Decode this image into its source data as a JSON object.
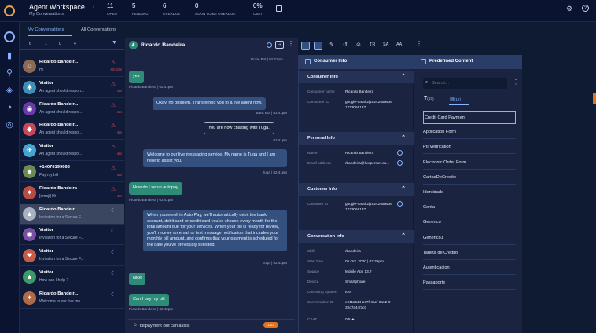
{
  "header": {
    "title": "Agent Workspace",
    "subtitle": "My Conversations",
    "stats": [
      {
        "value": "11",
        "label": "OPEN"
      },
      {
        "value": "5",
        "label": "PENDING"
      },
      {
        "value": "6",
        "label": "OVERDUE"
      },
      {
        "value": "0",
        "label": "SOON TO BE OVERDUE"
      },
      {
        "value": "0%",
        "label": "CSAT"
      }
    ]
  },
  "tabs": {
    "mine": "My Conversations",
    "all": "All Conversations"
  },
  "counts": [
    "6",
    "1",
    "0",
    "4"
  ],
  "conversations": [
    {
      "name": "Ricardo Bandeir...",
      "preview": "Hi",
      "time": "4m 15s",
      "color": "#8b6a55",
      "icon": "☺"
    },
    {
      "name": "Visitor",
      "preview": "An agent should respon...",
      "time": "4m",
      "color": "#3d8fb6",
      "icon": "✱"
    },
    {
      "name": "Ricardo Bandeir...",
      "preview": "An agent should respo...",
      "time": "4m",
      "color": "#6a3ba8",
      "icon": "◉"
    },
    {
      "name": "Ricardo Bandeir...",
      "preview": "An agent should respo...",
      "time": "4m",
      "color": "#c9475a",
      "icon": "◆"
    },
    {
      "name": "Visitor",
      "preview": "An agent should respo...",
      "time": "4m",
      "color": "#47a4d1",
      "icon": "✈"
    },
    {
      "name": "+14076199663",
      "preview": "Pay my bill",
      "time": "4m",
      "color": "#6b8b52",
      "icon": "☻"
    },
    {
      "name": "Ricardo Bandeira",
      "preview": "[emoji] Hi",
      "time": "4m",
      "color": "#b84e43",
      "icon": "✷"
    },
    {
      "name": "Ricardo Bandeir...",
      "preview": "Invitation for a Secure F...",
      "time": "",
      "color": "#a8b2c2",
      "icon": "▲"
    },
    {
      "name": "Visitor",
      "preview": "Invitation for a Secure F...",
      "time": "",
      "color": "#7b4fa4",
      "icon": "◉"
    },
    {
      "name": "Visitor",
      "preview": "Invitation for a Secure F...",
      "time": "",
      "color": "#c65b4a",
      "icon": "❤"
    },
    {
      "name": "Visitor",
      "preview": "How can I help ?",
      "time": "",
      "color": "#3d9a6a",
      "icon": "▲"
    },
    {
      "name": "Ricardo Bandeir...",
      "preview": "Welcome to our live me...",
      "time": "",
      "color": "#b06a47",
      "icon": "✶"
    }
  ],
  "chat": {
    "contact": "Ricardo Bandeira",
    "top_meta": "Rosie Bot | 02:41pm",
    "messages": [
      {
        "dir": "in",
        "text": "yes",
        "meta": "Ricardo Bandeira | 02:41pm"
      },
      {
        "dir": "out",
        "text": "Okay, no problem. Transferring you to a live agent now.",
        "meta": "Bank Bot | 02:41pm"
      },
      {
        "dir": "sys",
        "text": "You are now chatting with Tuga.",
        "meta": "02:41pm"
      },
      {
        "dir": "out",
        "text": "Welcome to our live messaging service. My name is Tuga and I am here to assist you.",
        "meta": "Tuga | 02:41pm"
      },
      {
        "dir": "in",
        "text": "How do I setup autopay",
        "meta": "Ricardo Bandeira | 02:41pm"
      },
      {
        "dir": "out",
        "text": "When you enroll in Auto Pay, we'll automatically debit the bank account, debit card or credit card you've chosen every month for the total amount due for your services. When your bill is ready for review, you'll receive an email or text message notification that includes your monthly bill amount, and confirms that your payment is scheduled for the date you've previously selected.",
        "meta": "Tuga | 02:42pm"
      },
      {
        "dir": "in",
        "text": "Nice",
        "meta": ""
      },
      {
        "dir": "in",
        "text": "Can I pay my bill",
        "meta": "Ricardo Bandeira | 02:42pm"
      }
    ],
    "bot_assist": "billpayment Bot can assist",
    "bot_badge": "1:23"
  },
  "consumer": {
    "title": "Consumer Info",
    "sections": [
      {
        "title": "Consumer Info",
        "fields": [
          [
            "Consumer name",
            "Ricardo Bandeira"
          ],
          [
            "Consumer ID",
            "google-oauth2|102425595361773066137"
          ]
        ]
      },
      {
        "title": "Personal Info",
        "fields": [
          [
            "Name",
            "Ricardo Bandeira"
          ],
          [
            "Email address",
            "rbandeira@liveperson.co..."
          ]
        ]
      },
      {
        "title": "Customer Info",
        "fields": [
          [
            "Customer ID",
            "google-oauth2|102425595361773066137"
          ]
        ]
      },
      {
        "title": "Conversation Info",
        "fields": [
          [
            "Skill",
            "rbandeira"
          ],
          [
            "Start time",
            "06 Oct. 2020 | 02:39pm"
          ],
          [
            "Source",
            "Mobile App 13.7"
          ],
          [
            "Device",
            "Smartphone"
          ],
          [
            "Operating System",
            "IOS"
          ],
          [
            "Conversation ID",
            "e2112114-a77f-4acf-8a62-032d7a44f7c0"
          ],
          [
            "CSAT",
            "0/5 ★"
          ]
        ]
      }
    ]
  },
  "predefined": {
    "title": "Predefined Content",
    "search_placeholder": "Search...",
    "type_counts": [
      "(57)",
      "(12)"
    ],
    "items": [
      "Credit Card Payment",
      "Application Form",
      "PII Verification",
      "Electronic Order Form",
      "CartaoDeCredito",
      "Identidade",
      "Conta",
      "Generico",
      "Generico1",
      "Tarjeta de Crédito",
      "Autenticacion",
      "Passaporte"
    ]
  },
  "colors": {
    "accent": "#8ab4ff",
    "in_bubble": "#2d8c78",
    "out_bubble": "#34507e",
    "alert": "#e0474c",
    "badge": "#e2731f"
  }
}
